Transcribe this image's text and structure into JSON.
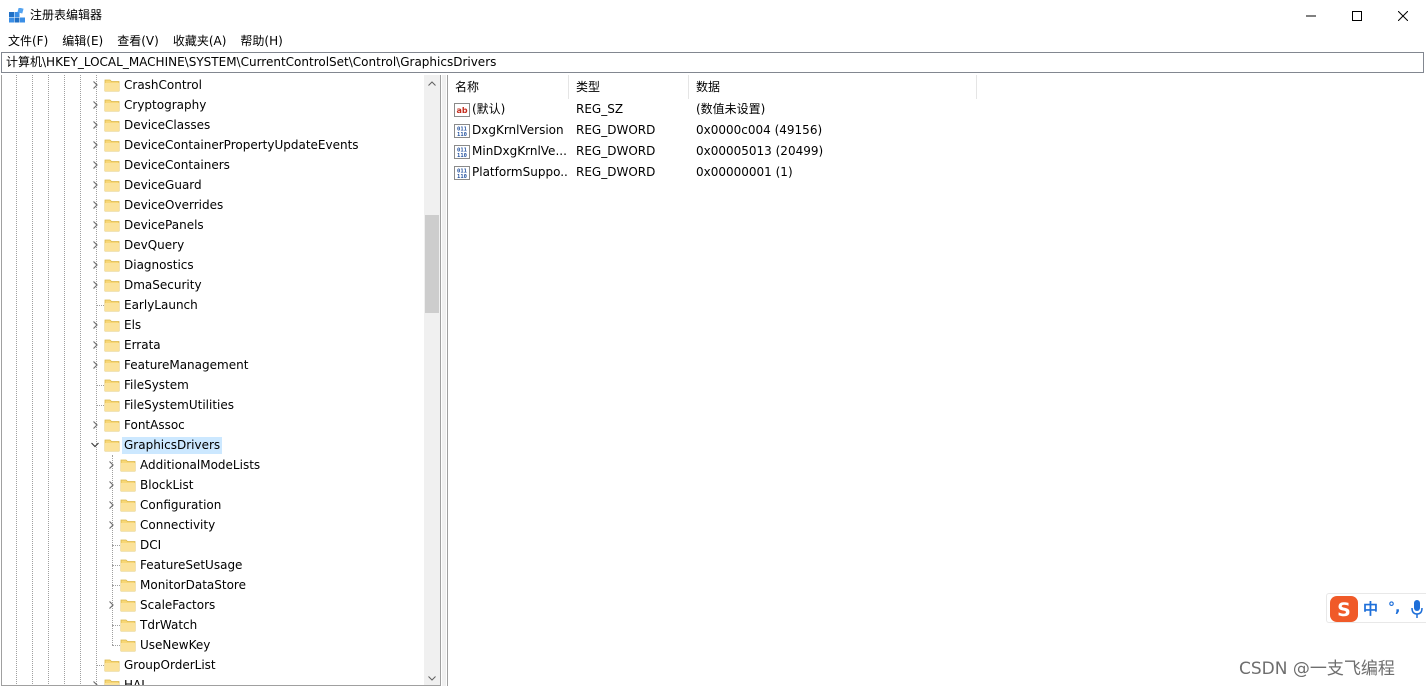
{
  "window": {
    "title": "注册表编辑器",
    "app_icon": "regedit-icon",
    "controls": [
      "minimize-icon",
      "maximize-icon",
      "close-icon"
    ]
  },
  "menu": [
    {
      "label": "文件(F)"
    },
    {
      "label": "编辑(E)"
    },
    {
      "label": "查看(V)"
    },
    {
      "label": "收藏夹(A)"
    },
    {
      "label": "帮助(H)"
    }
  ],
  "address": {
    "path": "计算机\\HKEY_LOCAL_MACHINE\\SYSTEM\\CurrentControlSet\\Control\\GraphicsDrivers"
  },
  "tree": {
    "items": [
      {
        "label": "CrashControl",
        "level": 1,
        "expandable": true
      },
      {
        "label": "Cryptography",
        "level": 1,
        "expandable": true
      },
      {
        "label": "DeviceClasses",
        "level": 1,
        "expandable": true
      },
      {
        "label": "DeviceContainerPropertyUpdateEvents",
        "level": 1,
        "expandable": true
      },
      {
        "label": "DeviceContainers",
        "level": 1,
        "expandable": true
      },
      {
        "label": "DeviceGuard",
        "level": 1,
        "expandable": true
      },
      {
        "label": "DeviceOverrides",
        "level": 1,
        "expandable": true
      },
      {
        "label": "DevicePanels",
        "level": 1,
        "expandable": true
      },
      {
        "label": "DevQuery",
        "level": 1,
        "expandable": true
      },
      {
        "label": "Diagnostics",
        "level": 1,
        "expandable": true
      },
      {
        "label": "DmaSecurity",
        "level": 1,
        "expandable": true
      },
      {
        "label": "EarlyLaunch",
        "level": 1,
        "expandable": false
      },
      {
        "label": "Els",
        "level": 1,
        "expandable": true
      },
      {
        "label": "Errata",
        "level": 1,
        "expandable": true
      },
      {
        "label": "FeatureManagement",
        "level": 1,
        "expandable": true
      },
      {
        "label": "FileSystem",
        "level": 1,
        "expandable": false
      },
      {
        "label": "FileSystemUtilities",
        "level": 1,
        "expandable": false
      },
      {
        "label": "FontAssoc",
        "level": 1,
        "expandable": true
      },
      {
        "label": "GraphicsDrivers",
        "level": 1,
        "expandable": true,
        "expanded": true,
        "selected": true
      },
      {
        "label": "AdditionalModeLists",
        "level": 2,
        "expandable": true
      },
      {
        "label": "BlockList",
        "level": 2,
        "expandable": true
      },
      {
        "label": "Configuration",
        "level": 2,
        "expandable": true
      },
      {
        "label": "Connectivity",
        "level": 2,
        "expandable": true
      },
      {
        "label": "DCI",
        "level": 2,
        "expandable": false
      },
      {
        "label": "FeatureSetUsage",
        "level": 2,
        "expandable": false
      },
      {
        "label": "MonitorDataStore",
        "level": 2,
        "expandable": false
      },
      {
        "label": "ScaleFactors",
        "level": 2,
        "expandable": true
      },
      {
        "label": "TdrWatch",
        "level": 2,
        "expandable": false
      },
      {
        "label": "UseNewKey",
        "level": 2,
        "expandable": false
      },
      {
        "label": "GroupOrderList",
        "level": 1,
        "expandable": false
      },
      {
        "label": "HAL",
        "level": 1,
        "expandable": true
      }
    ]
  },
  "list": {
    "columns": [
      {
        "label": "名称"
      },
      {
        "label": "类型"
      },
      {
        "label": "数据"
      }
    ],
    "rows": [
      {
        "icon": "string-value-icon",
        "name": "(默认)",
        "type": "REG_SZ",
        "data": "(数值未设置)"
      },
      {
        "icon": "binary-value-icon",
        "name": "DxgKrnlVersion",
        "type": "REG_DWORD",
        "data": "0x0000c004 (49156)"
      },
      {
        "icon": "binary-value-icon",
        "name": "MinDxgKrnlVe...",
        "type": "REG_DWORD",
        "data": "0x00005013 (20499)"
      },
      {
        "icon": "binary-value-icon",
        "name": "PlatformSuppo...",
        "type": "REG_DWORD",
        "data": "0x00000001 (1)"
      }
    ]
  },
  "ime": {
    "mode": "中",
    "punct": "°,",
    "icons": [
      "sogou-logo-icon",
      "microphone-icon"
    ]
  },
  "watermark": "CSDN @一支飞编程",
  "colors": {
    "selection": "#cce8ff",
    "folder": "#f8d775",
    "ime_blue": "#1e6fd9",
    "ime_orange": "#f05a28"
  }
}
